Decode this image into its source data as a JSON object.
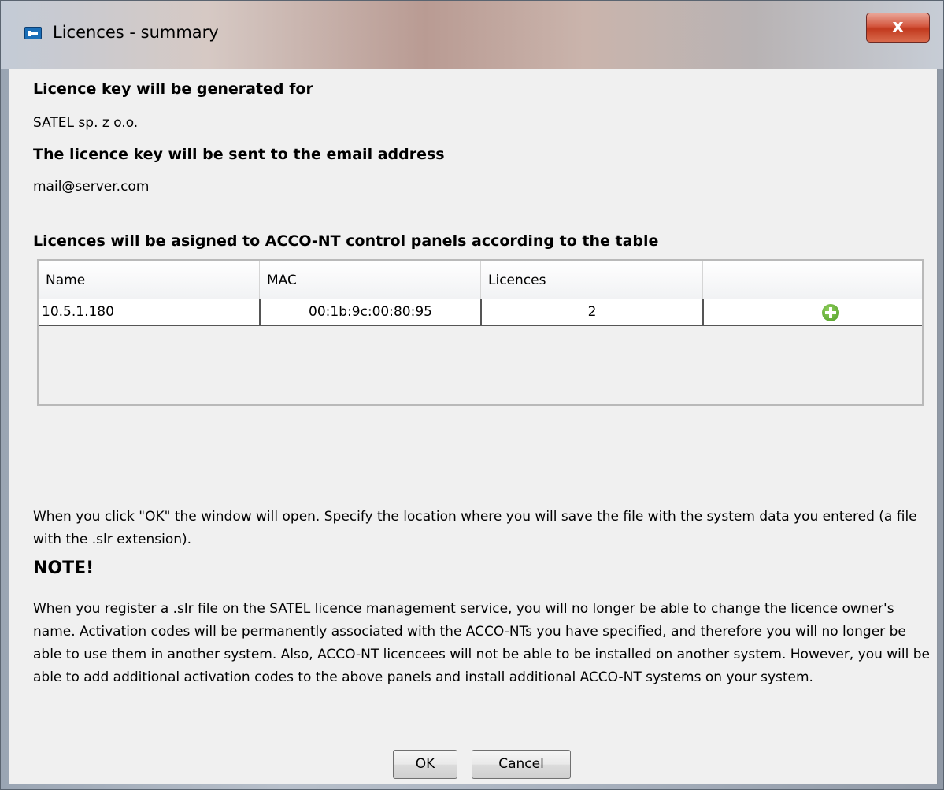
{
  "window": {
    "title": "Licences -  summary",
    "close_label": "x"
  },
  "summary": {
    "generated_for_label": "Licence key will be generated for",
    "owner_name": "SATEL sp. z o.o.",
    "email_label": "The licence key will be sent to the email address",
    "email": "mail@server.com",
    "table_label": "Licences will be asigned to ACCO-NT control panels according to the table"
  },
  "table": {
    "headers": [
      "Name",
      "MAC",
      "Licences",
      ""
    ],
    "rows": [
      {
        "name": "10.5.1.180",
        "mac": "00:1b:9c:00:80:95",
        "licences": "2",
        "action_icon": "add-icon"
      }
    ]
  },
  "info_text": "When you click \"OK\" the window will open. Specify the location where you will save the file with the system data you entered (a file with the .slr extension).",
  "note": {
    "title": "NOTE!",
    "text": "When you register a .slr file on the SATEL licence management service, you will no longer be able to change the licence owner's name. Activation codes will be permanently associated with the ACCO-NTs you have specified, and therefore you will no longer be able to use them in another system. Also, ACCO-NT licencees will not be able to be installed on another system. However, you will be able to add additional activation codes to the above panels and install additional ACCO-NT systems on your system."
  },
  "buttons": {
    "ok": "OK",
    "cancel": "Cancel"
  }
}
